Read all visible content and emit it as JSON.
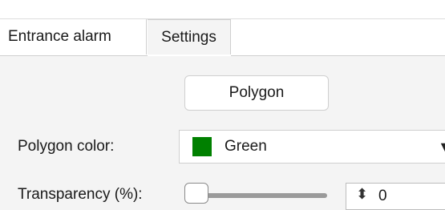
{
  "tabs": [
    {
      "label": "Entrance alarm"
    },
    {
      "label": "Settings"
    }
  ],
  "polygon_button": {
    "label": "Polygon"
  },
  "polygon_color": {
    "label": "Polygon color:",
    "value": "Green",
    "swatch_color": "#008000"
  },
  "transparency": {
    "label": "Transparency (%):",
    "value": "0"
  }
}
